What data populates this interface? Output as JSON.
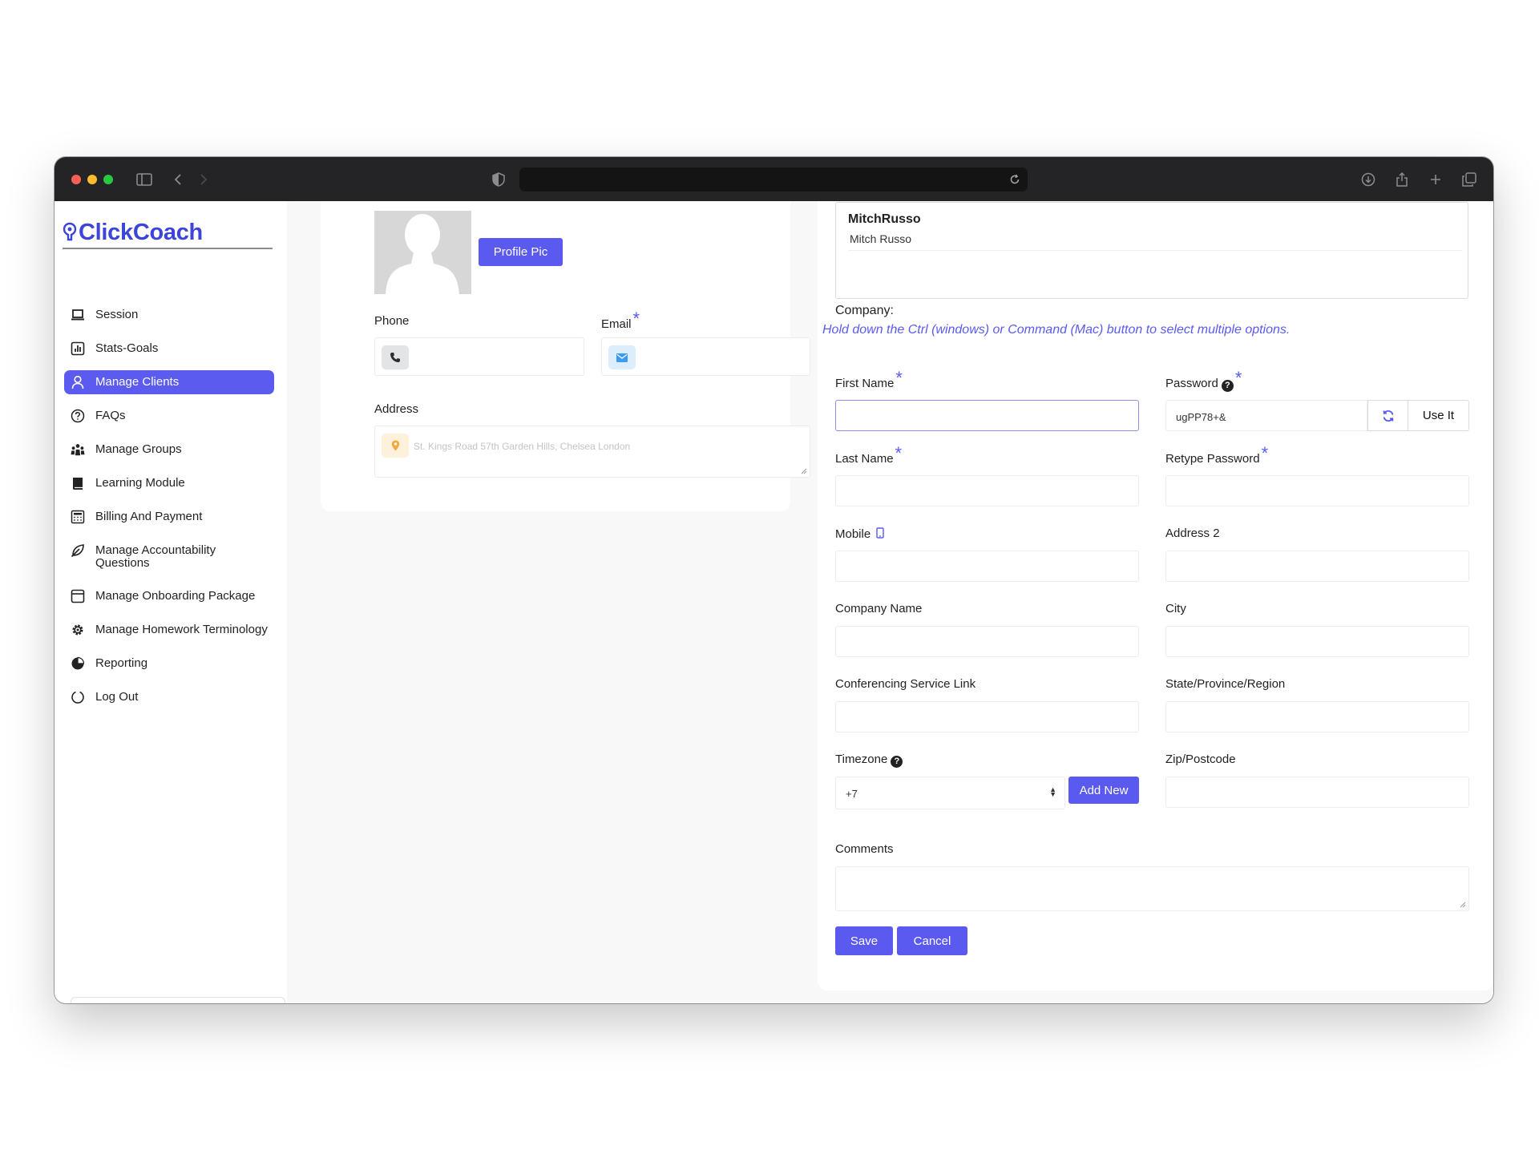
{
  "brand": {
    "name": "ClickCoach"
  },
  "colors": {
    "accent": "#5a5af1",
    "brand": "#3d45d9",
    "chrome": "#242426"
  },
  "sidebar": {
    "items": [
      {
        "label": "Session",
        "icon": "laptop-icon"
      },
      {
        "label": "Stats-Goals",
        "icon": "bar-chart-icon"
      },
      {
        "label": "Manage Clients",
        "icon": "user-icon",
        "active": true
      },
      {
        "label": "FAQs",
        "icon": "help-circle-icon"
      },
      {
        "label": "Manage Groups",
        "icon": "users-icon"
      },
      {
        "label": "Learning Module",
        "icon": "book-icon"
      },
      {
        "label": "Billing And Payment",
        "icon": "billing-icon"
      },
      {
        "label": "Manage Accountability Questions",
        "icon": "leaf-icon"
      },
      {
        "label": "Manage Onboarding Package",
        "icon": "package-icon"
      },
      {
        "label": "Manage Homework Terminology",
        "icon": "cog-icon"
      },
      {
        "label": "Reporting",
        "icon": "pie-chart-icon"
      },
      {
        "label": "Log Out",
        "icon": "logout-icon"
      }
    ]
  },
  "left_card": {
    "profile_pic_button": "Profile Pic",
    "phone_label": "Phone",
    "email_label": "Email",
    "address_label": "Address",
    "address_placeholder": "St. Kings Road 57th Garden Hills, Chelsea London",
    "required_mark": "*"
  },
  "right_card": {
    "selected_coach": {
      "name": "MitchRusso",
      "option": "Mitch Russo"
    },
    "company_label": "Company:",
    "hint": "Hold down the Ctrl (windows) or Command (Mac) button to select multiple options.",
    "first_name_label": "First Name",
    "password_label": "Password",
    "password_value": "ugPP78+&",
    "use_it_button": "Use It",
    "last_name_label": "Last Name",
    "retype_password_label": "Retype Password",
    "mobile_label": "Mobile",
    "address2_label": "Address 2",
    "company_name_label": "Company Name",
    "city_label": "City",
    "conferencing_label": "Conferencing Service Link",
    "state_label": "State/Province/Region",
    "timezone_label": "Timezone",
    "timezone_value": "+7",
    "add_new_button": "Add New",
    "zip_label": "Zip/Postcode",
    "comments_label": "Comments",
    "save_button": "Save",
    "cancel_button": "Cancel",
    "required_mark": "*"
  }
}
